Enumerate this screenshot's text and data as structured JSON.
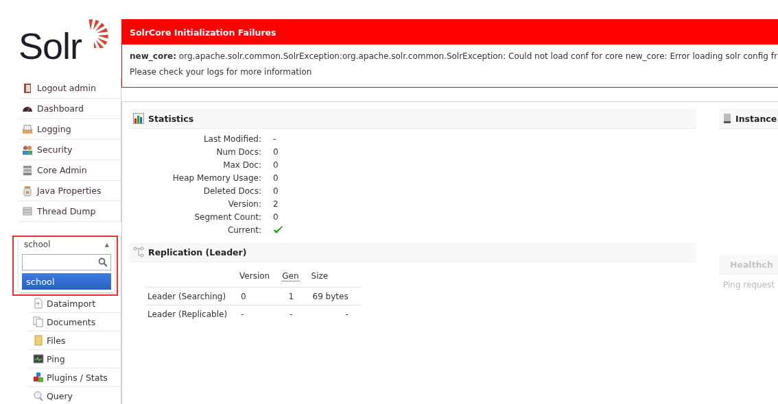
{
  "logo": {
    "text": "Solr"
  },
  "nav": [
    {
      "label": "Logout admin"
    },
    {
      "label": "Dashboard"
    },
    {
      "label": "Logging"
    },
    {
      "label": "Security"
    },
    {
      "label": "Core Admin"
    },
    {
      "label": "Java Properties"
    },
    {
      "label": "Thread Dump"
    }
  ],
  "core_selector": {
    "value": "school",
    "caret": "▲",
    "expanded": true,
    "options": [
      {
        "label": "school",
        "selected": true
      }
    ]
  },
  "core_menu": [
    {
      "label": "Dataimport"
    },
    {
      "label": "Documents"
    },
    {
      "label": "Files"
    },
    {
      "label": "Ping"
    },
    {
      "label": "Plugins / Stats"
    },
    {
      "label": "Query"
    }
  ],
  "error_box": {
    "title": "SolrCore Initialization Failures",
    "core": "new_core:",
    "message": "org.apache.solr.common.SolrException:org.apache.solr.common.SolrException: Could not load conf for core new_core: Error loading solr config fr",
    "note": "Please check your logs for more information"
  },
  "statistics": {
    "title": "Statistics",
    "rows": [
      {
        "label": "Last Modified:",
        "value": "-"
      },
      {
        "label": "Num Docs:",
        "value": "0"
      },
      {
        "label": "Max Doc:",
        "value": "0"
      },
      {
        "label": "Heap Memory Usage:",
        "value": "0"
      },
      {
        "label": "Deleted Docs:",
        "value": "0"
      },
      {
        "label": "Version:",
        "value": "2"
      },
      {
        "label": "Segment Count:",
        "value": "0"
      },
      {
        "label": "Current:",
        "kind": "check",
        "current": true
      }
    ]
  },
  "replication": {
    "title": "Replication (Leader)",
    "columns": [
      "",
      "Version",
      "Gen",
      "Size"
    ],
    "rows": [
      [
        "Leader (Searching)",
        "0",
        "1",
        "69 bytes"
      ],
      [
        "Leader (Replicable)",
        "-",
        "-",
        "-"
      ]
    ]
  },
  "instance": {
    "title": "Instance"
  },
  "healthcheck": {
    "title": "Healthch",
    "disabled": true,
    "text": "Ping request"
  }
}
